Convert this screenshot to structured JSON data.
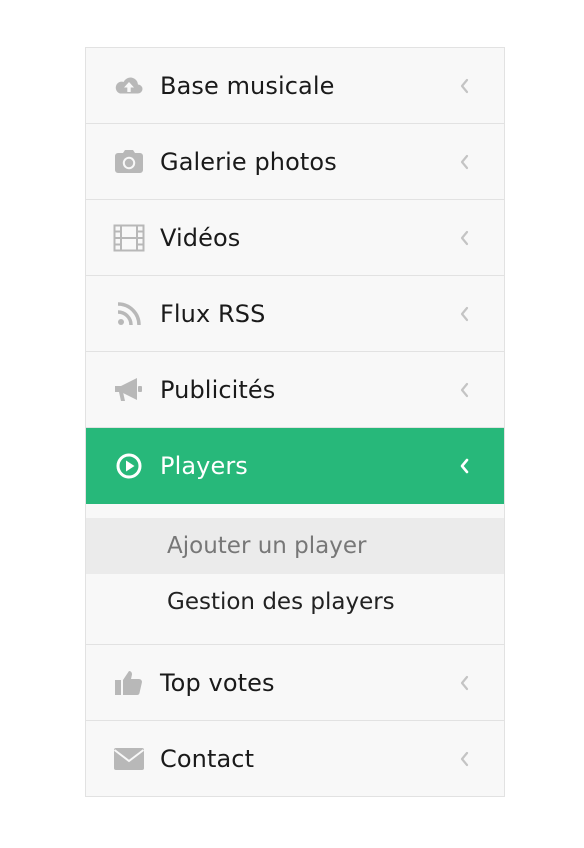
{
  "menu": {
    "items": [
      {
        "label": "Base musicale",
        "icon": "cloud-upload-icon"
      },
      {
        "label": "Galerie photos",
        "icon": "camera-icon"
      },
      {
        "label": "Vidéos",
        "icon": "film-icon"
      },
      {
        "label": "Flux RSS",
        "icon": "rss-icon"
      },
      {
        "label": "Publicités",
        "icon": "bullhorn-icon"
      },
      {
        "label": "Players",
        "icon": "play-circle-icon",
        "active": true
      },
      {
        "label": "Top votes",
        "icon": "thumbs-up-icon"
      },
      {
        "label": "Contact",
        "icon": "envelope-icon"
      }
    ],
    "players_submenu": [
      {
        "label": "Ajouter un player"
      },
      {
        "label": "Gestion des players"
      }
    ]
  },
  "colors": {
    "accent": "#27b87a",
    "icon_gray": "#b8b8b8",
    "background": "#f8f8f8",
    "border": "#e2e2e2",
    "submenu_hover": "#ebebeb"
  }
}
